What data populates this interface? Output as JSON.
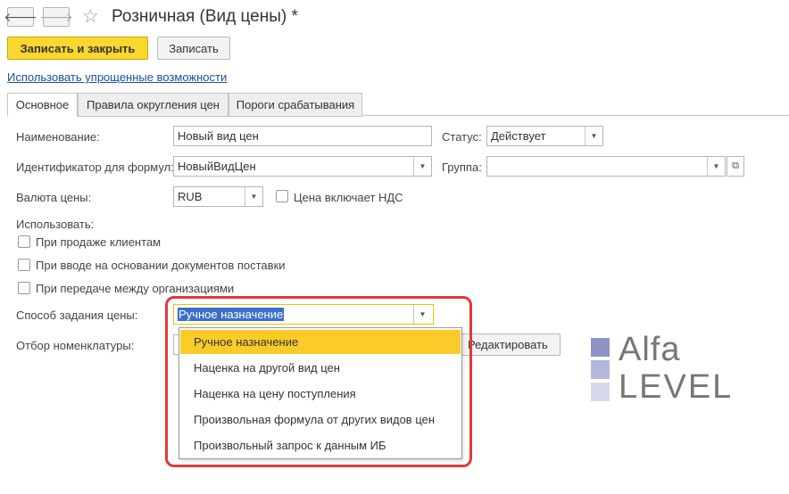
{
  "header": {
    "title": "Розничная (Вид цены) *",
    "back_glyph": "🡐",
    "forward_glyph": "🡒",
    "star_glyph": "☆"
  },
  "toolbar": {
    "save_close_label": "Записать и закрыть",
    "save_label": "Записать"
  },
  "simplified_link": "Использовать упрощенные возможности",
  "tabs": [
    {
      "label": "Основное",
      "active": true
    },
    {
      "label": "Правила округления цен",
      "active": false
    },
    {
      "label": "Пороги срабатывания",
      "active": false
    }
  ],
  "form": {
    "name_label": "Наименование:",
    "name_value": "Новый вид цен",
    "status_label": "Статус:",
    "status_value": "Действует",
    "formula_id_label": "Идентификатор для формул:",
    "formula_id_value": "НовыйВидЦен",
    "group_label": "Группа:",
    "group_value": "",
    "currency_label": "Валюта цены:",
    "currency_value": "RUB",
    "vat_label": "Цена включает НДС",
    "use_label": "Использовать:",
    "use_options": [
      "При продаже клиентам",
      "При вводе на основании документов поставки",
      "При передаче между организациями"
    ],
    "price_method_label": "Способ задания цены:",
    "price_method_value": "Ручное назначение",
    "nomenclature_filter_label": "Отбор номенклатуры:",
    "edit_button_label": "Редактировать"
  },
  "dropdown": {
    "options": [
      "Ручное назначение",
      "Наценка на другой вид цен",
      "Наценка на цену поступления",
      "Произвольная формула от других видов цен",
      "Произвольный запрос к данным ИБ"
    ],
    "selected_index": 0
  },
  "logo": {
    "line1": "Alfa",
    "line2": "LEVEL",
    "colors": [
      "#8e93c6",
      "#b3b7dc",
      "#d6d8ee"
    ]
  },
  "colors": {
    "primary_button": "#fbd72f",
    "selected_option": "#fbcb2a",
    "highlight_frame": "#e03a3a",
    "link": "#1a4fa3"
  }
}
